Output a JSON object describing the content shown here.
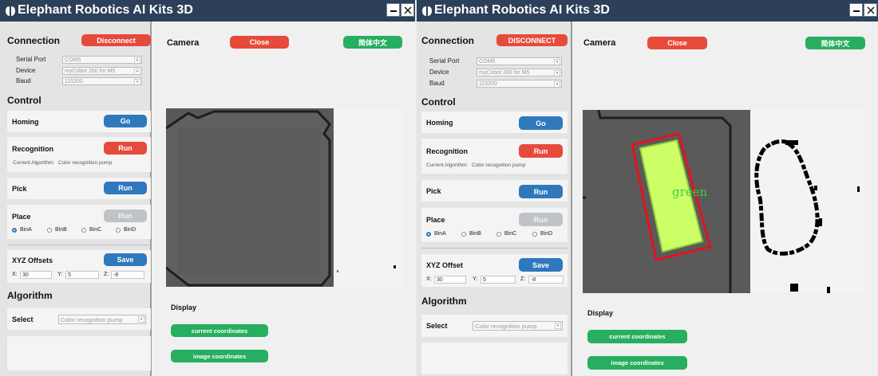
{
  "app_title": "Elephant Robotics AI Kits 3D",
  "left": {
    "connection": {
      "title": "Connection",
      "button": "Disconnect",
      "serial_port_label": "Serial Port",
      "serial_port": "COM5",
      "device_label": "Device",
      "device": "myCobot 280 for M5",
      "baud_label": "Baud",
      "baud": "115200"
    },
    "control": {
      "title": "Control",
      "homing": {
        "label": "Homing",
        "button": "Go"
      },
      "recognition": {
        "label": "Recognition",
        "button": "Run",
        "algorithm_label": "Current Algorithm:",
        "algorithm": "Color recognition pump"
      },
      "pick": {
        "label": "Pick",
        "button": "Run"
      },
      "place": {
        "label": "Place",
        "button": "Run",
        "bins": [
          "BinA",
          "BinB",
          "BinC",
          "BinD"
        ],
        "selected": "BinA"
      },
      "offsets": {
        "label": "XYZ Offsets",
        "button": "Save",
        "x_label": "X:",
        "x": "30",
        "y_label": "Y:",
        "y": "5",
        "z_label": "Z:",
        "z": "-8"
      }
    },
    "algorithm": {
      "title": "Algorithm",
      "select_label": "Select",
      "select_value": "Color recognition pump"
    },
    "camera": {
      "title": "Camera",
      "close_button": "Close",
      "lang_button": "简体中文"
    },
    "display": {
      "title": "Display",
      "btn_current": "current coordinates",
      "btn_image": "image coordinates"
    }
  },
  "right": {
    "connection": {
      "title": "Connection",
      "button": "DISCONNECT",
      "serial_port_label": "Serial Port",
      "serial_port": "COM5",
      "device_label": "Device",
      "device": "myCobot 280 for M5",
      "baud_label": "Baud",
      "baud": "115200"
    },
    "control": {
      "title": "Control",
      "homing": {
        "label": "Homing",
        "button": "Go"
      },
      "recognition": {
        "label": "Recognition",
        "button": "Run",
        "algorithm_label": "Current Algorithm:",
        "algorithm": "Color recognition pump"
      },
      "pick": {
        "label": "Pick",
        "button": "Run"
      },
      "place": {
        "label": "Place",
        "button": "Run",
        "bins": [
          "BinA",
          "BinB",
          "BinC",
          "BinD"
        ],
        "selected": "BinA"
      },
      "offsets": {
        "label": "XYZ Offset",
        "button": "Save",
        "x_label": "X:",
        "x": "30",
        "y_label": "Y:",
        "y": "5",
        "z_label": "Z:",
        "z": "-8"
      }
    },
    "algorithm": {
      "title": "Algorithm",
      "select_label": "Select",
      "select_value": "Color recognition pump"
    },
    "camera": {
      "title": "Camera",
      "close_button": "Close",
      "lang_button": "简体中文",
      "detected_label": "green"
    },
    "display": {
      "title": "Display",
      "btn_current": "current coordinates",
      "btn_image": "image coordinates"
    }
  },
  "colors": {
    "titlebar": "#2c4059",
    "red": "#e64a3b",
    "blue": "#2f78bd",
    "green": "#27ae60",
    "detect_box": "#e0141e",
    "detect_fill": "#ccff66"
  }
}
